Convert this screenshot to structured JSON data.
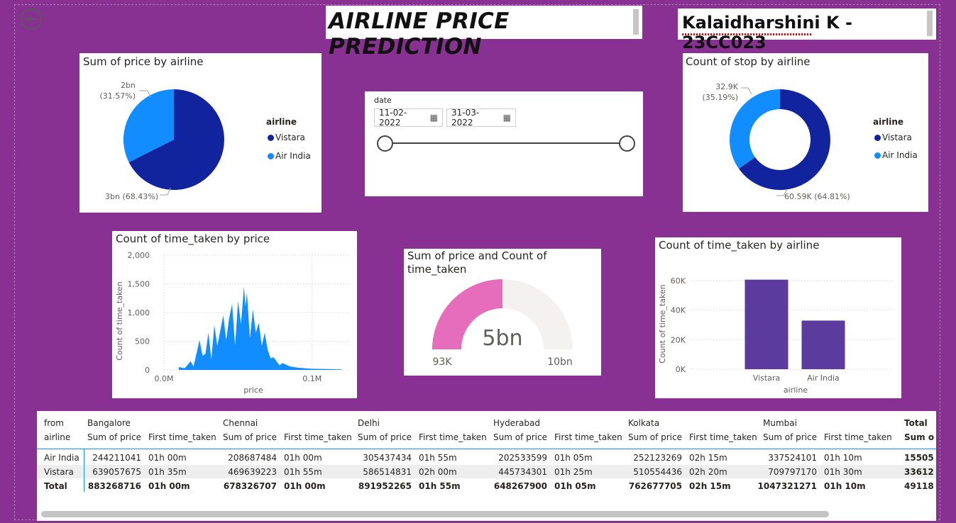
{
  "header": {
    "title": "AIRLINE PRICE PREDICTION",
    "author": "Kalaidharshini K - 23CC023"
  },
  "colors": {
    "background": "#883193",
    "vistara": "#12239e",
    "air_india": "#118dff",
    "bar": "#5b3b9e",
    "gauge_fill": "#e66cbc",
    "gauge_track": "#f3f2f1"
  },
  "icons": {
    "back": "back-arrow-icon",
    "calendar": "calendar-icon"
  },
  "pie_price": {
    "title": "Sum of price by airline",
    "legend_title": "airline",
    "legend": [
      "Vistara",
      "Air India"
    ],
    "label_vistara": "3bn (68.43%)",
    "label_airindia_value": "2bn",
    "label_airindia_pct": "(31.57%)"
  },
  "date_slicer": {
    "label": "date",
    "start": "11-02-2022",
    "end": "31-03-2022",
    "range_selected": [
      0,
      1
    ]
  },
  "donut_stop": {
    "title": "Count of stop by airline",
    "legend_title": "airline",
    "legend": [
      "Vistara",
      "Air India"
    ],
    "label_vistara": "60.59K (64.81%)",
    "label_airindia_value": "32.9K",
    "label_airindia_pct": "(35.19%)"
  },
  "histogram": {
    "title": "Count of time_taken by price",
    "ylabel": "Count of time_taken",
    "xlabel": "price",
    "yticks": [
      "2,000",
      "1,500",
      "1,000",
      "500",
      "0"
    ],
    "xticks": [
      "0.0M",
      "0.1M"
    ]
  },
  "gauge": {
    "title_line1": "Sum of price and Count of",
    "title_line2": "time_taken",
    "value": "5bn",
    "min": "93K",
    "max": "10bn"
  },
  "bar_chart": {
    "title": "Count of time_taken by airline",
    "ylabel": "Count of time_taken",
    "xlabel": "airline",
    "yticks": [
      "60K",
      "40K",
      "20K",
      "0K"
    ]
  },
  "chart_data": [
    {
      "type": "pie",
      "title": "Sum of price by airline",
      "categories": [
        "Vistara",
        "Air India"
      ],
      "values": [
        3.361,
        1.551
      ],
      "percent": [
        68.43,
        31.57
      ],
      "unit": "bn"
    },
    {
      "type": "pie",
      "subtype": "donut",
      "title": "Count of stop by airline",
      "categories": [
        "Vistara",
        "Air India"
      ],
      "values": [
        60590,
        32900
      ],
      "percent": [
        64.81,
        35.19
      ]
    },
    {
      "type": "area",
      "title": "Count of time_taken by price",
      "xlabel": "price",
      "ylabel": "Count of time_taken",
      "xlim": [
        0,
        125000
      ],
      "ylim": [
        0,
        2000
      ],
      "x": [
        10000,
        14000,
        18000,
        20000,
        24000,
        26000,
        28000,
        30000,
        32000,
        34000,
        36000,
        38000,
        40000,
        42000,
        44000,
        46000,
        48000,
        50000,
        52000,
        54000,
        55000,
        56000,
        58000,
        60000,
        62000,
        64000,
        66000,
        68000,
        70000,
        72000,
        74000,
        76000,
        78000,
        80000,
        85000,
        90000,
        95000,
        100000,
        110000,
        120000
      ],
      "y": [
        50,
        30,
        150,
        60,
        520,
        250,
        280,
        650,
        180,
        780,
        420,
        680,
        950,
        520,
        900,
        1150,
        420,
        1200,
        800,
        1450,
        1100,
        1350,
        550,
        1050,
        650,
        820,
        420,
        650,
        350,
        200,
        220,
        150,
        80,
        120,
        60,
        40,
        30,
        20,
        15,
        10
      ]
    },
    {
      "type": "bar",
      "subtype": "gauge",
      "title": "Sum of price and Count of time_taken",
      "value": 5000000000,
      "min": 93000,
      "max": 10000000000
    },
    {
      "type": "bar",
      "title": "Count of time_taken by airline",
      "categories": [
        "Vistara",
        "Air India"
      ],
      "values": [
        60590,
        32900
      ],
      "ylim": [
        0,
        70000
      ],
      "xlabel": "airline",
      "ylabel": "Count of time_taken"
    }
  ],
  "matrix": {
    "row_header_top": "from",
    "row_header_bottom": "airline",
    "column_groups": [
      "Bangalore",
      "Chennai",
      "Delhi",
      "Hyderabad",
      "Kolkata",
      "Mumbai",
      "Total"
    ],
    "measure_price": "Sum of price",
    "measure_time": "First time_taken",
    "measure_total_partial": "Sum o",
    "rows": [
      {
        "label": "Air India",
        "cells": [
          "244211041",
          "01h 00m",
          "208687484",
          "01h 00m",
          "305437434",
          "01h 55m",
          "202533599",
          "01h 05m",
          "252123269",
          "02h 15m",
          "337524101",
          "01h 10m",
          "15505"
        ]
      },
      {
        "label": "Vistara",
        "cells": [
          "639057675",
          "01h 35m",
          "469639223",
          "01h 55m",
          "586514831",
          "02h 00m",
          "445734301",
          "01h 25m",
          "510554436",
          "02h 20m",
          "709797170",
          "01h 30m",
          "33612"
        ]
      },
      {
        "label": "Total",
        "cells": [
          "883268716",
          "01h 00m",
          "678326707",
          "01h 00m",
          "891952265",
          "01h 55m",
          "648267900",
          "01h 05m",
          "762677705",
          "02h 15m",
          "1047321271",
          "01h 10m",
          "49118"
        ]
      }
    ]
  }
}
